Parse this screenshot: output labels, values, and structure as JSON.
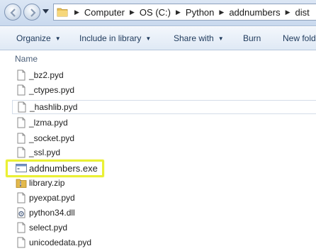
{
  "address": {
    "crumbs": [
      "Computer",
      "OS (C:)",
      "Python",
      "addnumbers",
      "dist"
    ],
    "separator": "▶"
  },
  "toolbar": {
    "organize": "Organize",
    "include_in_library": "Include in library",
    "share_with": "Share with",
    "burn": "Burn",
    "new_folder": "New fold",
    "caret": "▼"
  },
  "columns": {
    "name": "Name"
  },
  "files": [
    {
      "name": "_bz2.pyd",
      "icon": "document-icon"
    },
    {
      "name": "_ctypes.pyd",
      "icon": "document-icon"
    },
    {
      "name": "_hashlib.pyd",
      "icon": "document-icon"
    },
    {
      "name": "_lzma.pyd",
      "icon": "document-icon"
    },
    {
      "name": "_socket.pyd",
      "icon": "document-icon"
    },
    {
      "name": "_ssl.pyd",
      "icon": "document-icon"
    },
    {
      "name": "addnumbers.exe",
      "icon": "application-icon"
    },
    {
      "name": "library.zip",
      "icon": "zip-folder-icon"
    },
    {
      "name": "pyexpat.pyd",
      "icon": "document-icon"
    },
    {
      "name": "python34.dll",
      "icon": "dll-icon"
    },
    {
      "name": "select.pyd",
      "icon": "document-icon"
    },
    {
      "name": "unicodedata.pyd",
      "icon": "document-icon"
    }
  ],
  "highlighted_file": "addnumbers.exe",
  "colors": {
    "highlight": "#eaf034",
    "toolbar_text": "#1e395b"
  }
}
